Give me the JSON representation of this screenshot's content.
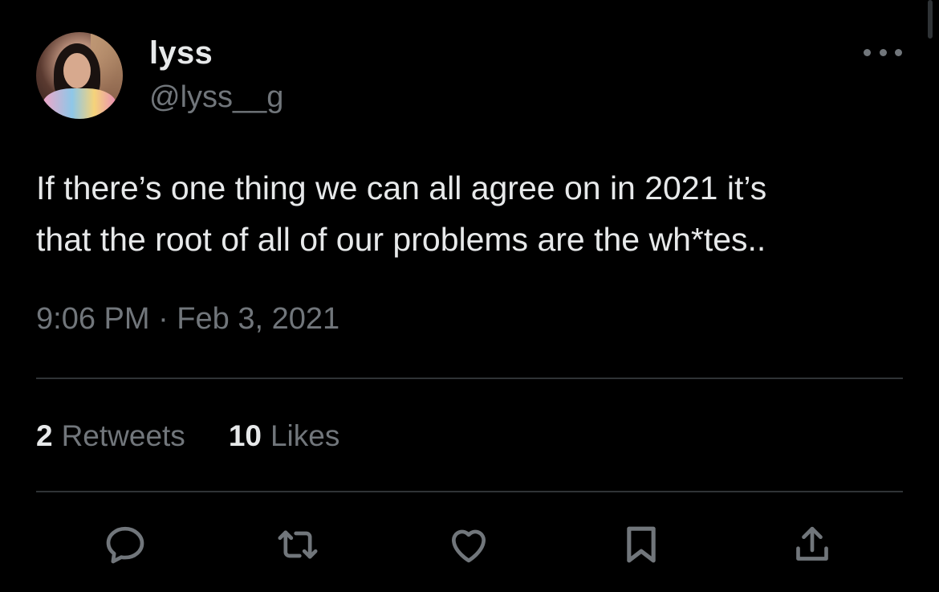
{
  "author": {
    "display_name": "lyss",
    "handle": "@lyss__g",
    "avatar_icon": "avatar-photo"
  },
  "tweet": {
    "text": "If there’s one thing we can all agree on in 2021 it’s\nthat the root of all of our problems are the wh*tes..",
    "timestamp": "9:06 PM · Feb 3, 2021"
  },
  "stats": {
    "retweets_count": "2",
    "retweets_label": "Retweets",
    "likes_count": "10",
    "likes_label": "Likes"
  },
  "actions": [
    {
      "icon": "reply-icon"
    },
    {
      "icon": "retweet-icon"
    },
    {
      "icon": "like-icon"
    },
    {
      "icon": "bookmark-icon"
    },
    {
      "icon": "share-icon"
    }
  ],
  "menu_icon": "more-dots-icon",
  "colors": {
    "background": "#000000",
    "primary_text": "#e7e9ea",
    "secondary_text": "#71767b",
    "divider": "#2f3336"
  }
}
